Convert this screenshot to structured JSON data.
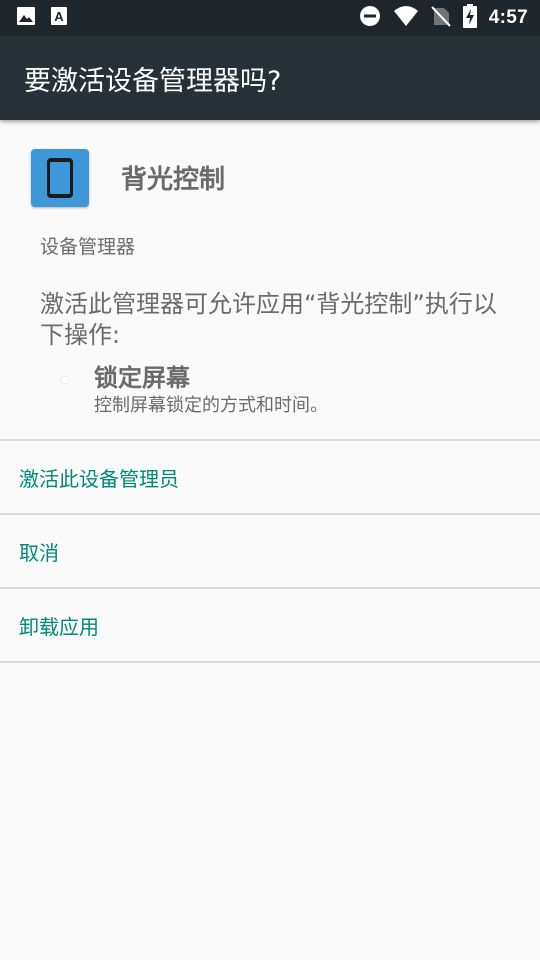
{
  "status_bar": {
    "time": "4:57",
    "left_icons": [
      "image-icon",
      "text-a-icon"
    ],
    "right_icons": [
      "dnd-icon",
      "wifi-icon",
      "no-sim-icon",
      "battery-charging-icon"
    ]
  },
  "app_bar": {
    "title": "要激活设备管理器吗?"
  },
  "app": {
    "name": "背光控制",
    "icon": "phone-icon"
  },
  "section_label": "设备管理器",
  "description": "激活此管理器可允许应用“背光控制”执行以下操作:",
  "policies": [
    {
      "title": "锁定屏幕",
      "description": "控制屏幕锁定的方式和时间。"
    }
  ],
  "actions": {
    "activate": "激活此设备管理员",
    "cancel": "取消",
    "uninstall": "卸载应用"
  },
  "colors": {
    "status_bar": "#1e262b",
    "app_bar": "#263238",
    "accent": "#00897b",
    "background": "#fafafa",
    "app_icon": "#3e97d8"
  }
}
